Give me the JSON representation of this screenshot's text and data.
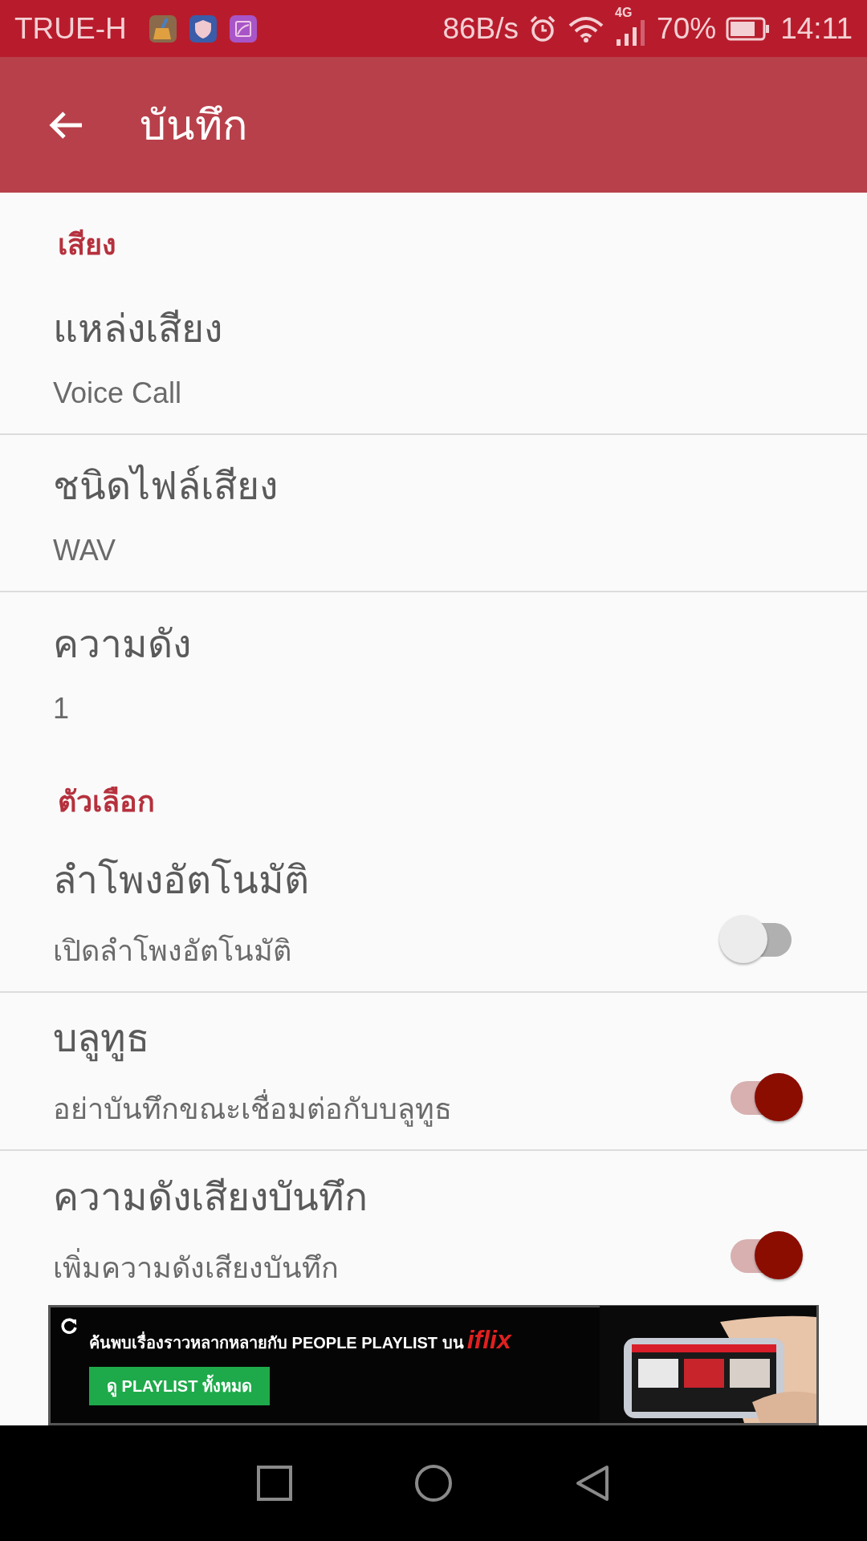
{
  "status_bar": {
    "carrier": "TRUE-H",
    "speed": "86B/s",
    "network": "4G",
    "battery": "70%",
    "time": "14:11"
  },
  "app_bar": {
    "title": "บันทึก"
  },
  "sections": [
    {
      "header": "เสียง",
      "items": [
        {
          "kind": "value",
          "title": "แหล่งเสียง",
          "summary": "Voice Call"
        },
        {
          "kind": "value",
          "title": "ชนิดไฟล์เสียง",
          "summary": "WAV"
        },
        {
          "kind": "value",
          "title": "ความดัง",
          "summary": "1"
        }
      ]
    },
    {
      "header": "ตัวเลือก",
      "items": [
        {
          "kind": "switch",
          "title": "ลำโพงอัตโนมัติ",
          "summary": "เปิดลำโพงอัตโนมัติ",
          "on": false
        },
        {
          "kind": "switch",
          "title": "บลูทูธ",
          "summary": "อย่าบันทึกขณะเชื่อมต่อกับบลูทูธ",
          "on": true
        },
        {
          "kind": "switch",
          "title": "ความดังเสียงบันทึก",
          "summary": "เพิ่มความดังเสียงบันทึก",
          "on": true
        }
      ]
    }
  ],
  "ad": {
    "headline": "ค้นพบเรื่องราวหลากหลายกับ PEOPLE PLAYLIST บน",
    "brand": "iflix",
    "button": "ดู PLAYLIST ทั้งหมด"
  }
}
